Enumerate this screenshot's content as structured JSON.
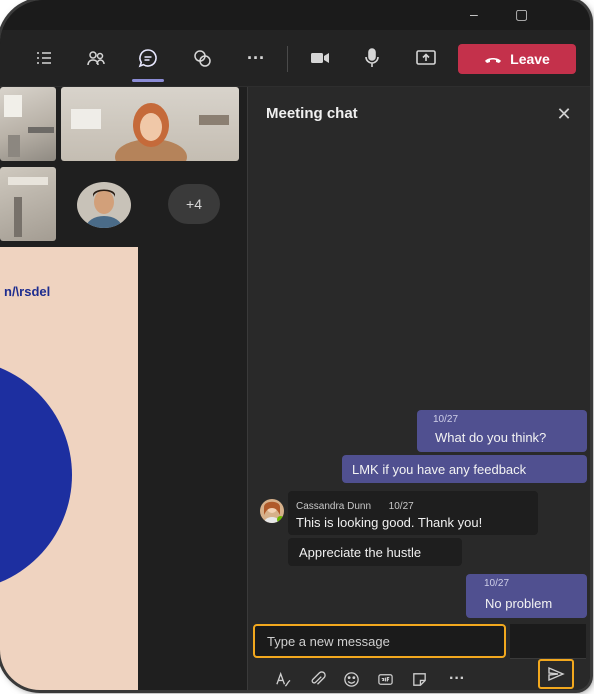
{
  "window": {
    "minimize_glyph": "–",
    "maximize_glyph": "▢"
  },
  "toolbar": {
    "items": [
      "list-icon",
      "people-icon",
      "chat-icon",
      "reactions-icon",
      "more-icon",
      "camera-icon",
      "mic-icon",
      "share-icon"
    ],
    "more_glyph": "···",
    "leave_label": "Leave",
    "leave_color": "#c4314b",
    "active_color": "#8b8cd6"
  },
  "stage": {
    "more_participants": "+4",
    "share_brand": "n/\\rsdel"
  },
  "chat": {
    "title": "Meeting chat",
    "close_glyph": "✕",
    "messages": [
      {
        "meta": "10/27",
        "text": "What do you think?"
      },
      {
        "text": "LMK if you have any feedback"
      },
      {
        "sender": "Cassandra Dunn",
        "meta": "10/27",
        "text": "This is looking good. Thank you!"
      },
      {
        "text": "Appreciate the hustle"
      },
      {
        "meta": "10/27",
        "text": "No problem"
      }
    ],
    "compose_placeholder": "Type a new message",
    "format_icons": [
      "format-icon",
      "attach-icon",
      "emoji-icon",
      "gif-icon",
      "sticker-icon",
      "more-options-icon"
    ],
    "more_glyph": "···",
    "bubble_color": "#505090",
    "highlight_color": "#f2a81e"
  }
}
